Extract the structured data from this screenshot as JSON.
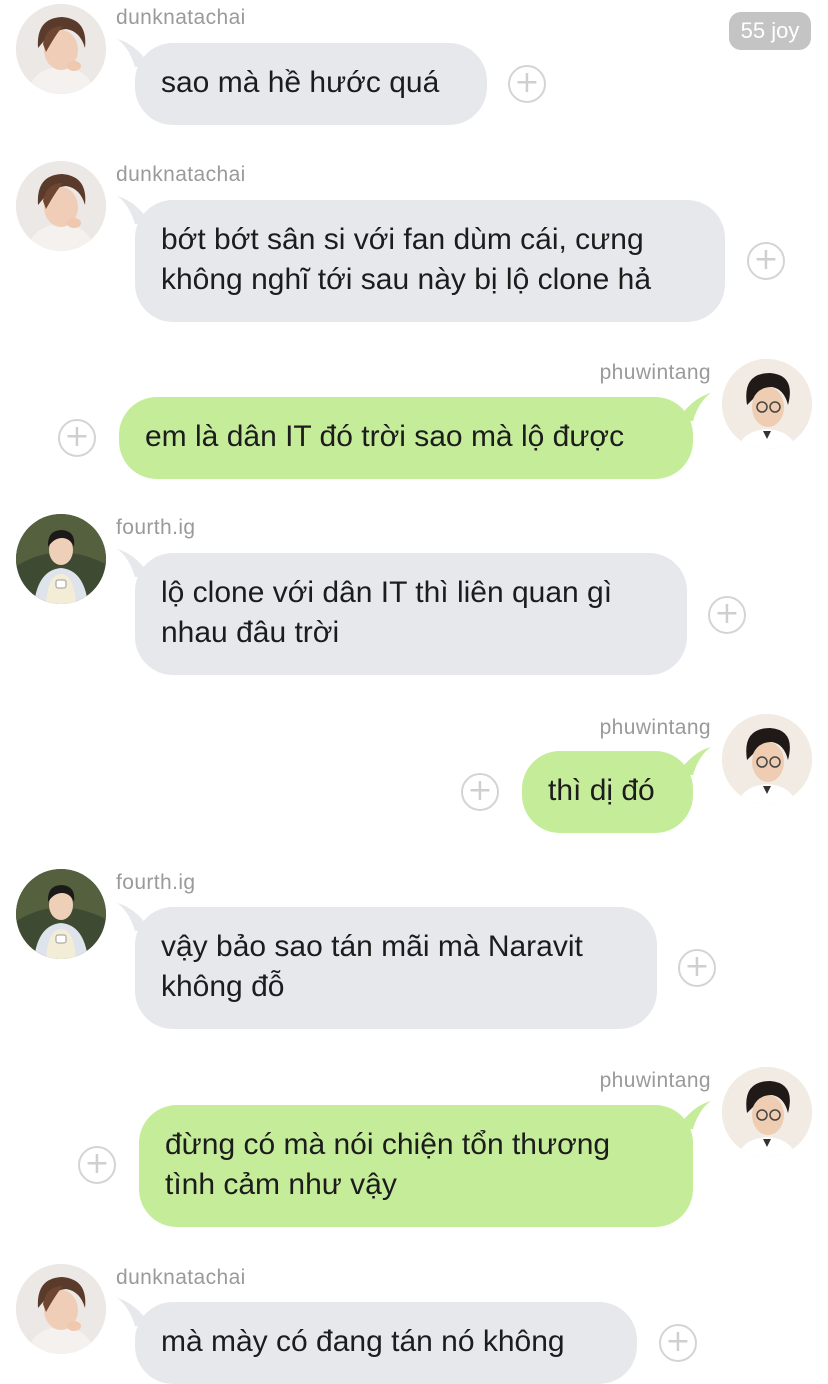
{
  "unread_badge": "55 joy",
  "users": {
    "dunk": "dunknatachai",
    "phuwin": "phuwintang",
    "fourth": "fourth.ig"
  },
  "icons": {
    "reaction": "add-reaction-icon"
  },
  "colors": {
    "incoming_bubble": "#e6e8ec",
    "outgoing_bubble": "#c5ec99",
    "sender_text": "#9a9a9a"
  },
  "messages": [
    {
      "sender": "dunknatachai",
      "direction": "incoming",
      "text": "sao mà hề hước quá"
    },
    {
      "sender": "dunknatachai",
      "direction": "incoming",
      "text": "bớt bớt sân si với fan dùm cái, cưng không nghĩ tới sau này bị lộ clone hả"
    },
    {
      "sender": "phuwintang",
      "direction": "outgoing",
      "text": "em là dân IT đó trời sao mà lộ được"
    },
    {
      "sender": "fourth.ig",
      "direction": "incoming",
      "text": "lộ clone với dân IT thì liên quan gì nhau đâu trời"
    },
    {
      "sender": "phuwintang",
      "direction": "outgoing",
      "text": "thì dị đó"
    },
    {
      "sender": "fourth.ig",
      "direction": "incoming",
      "text": "vậy bảo sao tán mãi mà Naravit không đỗ"
    },
    {
      "sender": "phuwintang",
      "direction": "outgoing",
      "text": "đừng có mà nói chiện tổn thương tình cảm như vậy"
    },
    {
      "sender": "dunknatachai",
      "direction": "incoming",
      "text": "mà mày có đang tán nó không"
    }
  ]
}
